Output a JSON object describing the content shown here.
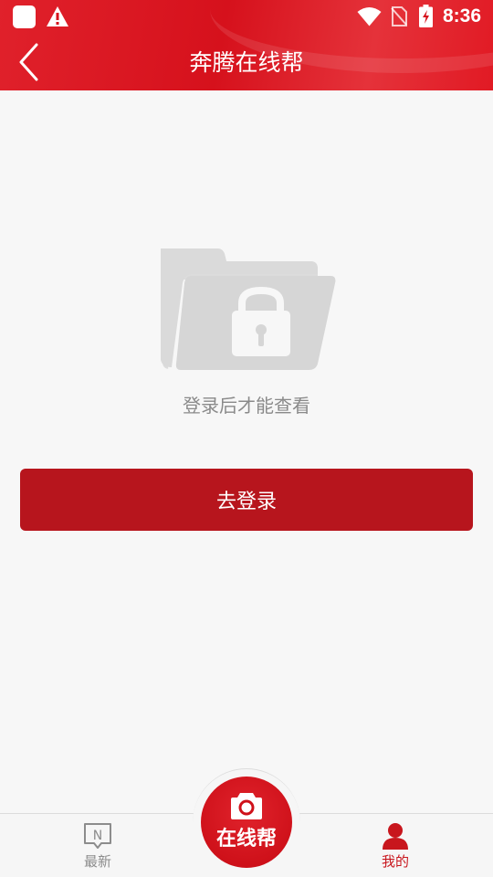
{
  "status_bar": {
    "time": "8:36",
    "icons": [
      "app-icon",
      "warning-icon",
      "wifi-icon",
      "no-sim-icon",
      "battery-charging-icon"
    ]
  },
  "header": {
    "title": "奔腾在线帮",
    "back_icon": "chevron-left-icon"
  },
  "main": {
    "illustration_icon": "locked-folder-icon",
    "message": "登录后才能查看",
    "login_button_label": "去登录"
  },
  "bottom_nav": {
    "items": [
      {
        "label": "最新",
        "icon": "news-n-icon",
        "active": false
      },
      {
        "label": "在线帮",
        "icon": "camera-icon",
        "active": false
      },
      {
        "label": "我的",
        "icon": "user-icon",
        "active": true
      }
    ]
  },
  "colors": {
    "brand_red": "#d6111c",
    "button_red": "#b7151d",
    "active_tab": "#c8161d",
    "inactive_tab": "#8c8c8c",
    "background": "#f7f7f7"
  }
}
